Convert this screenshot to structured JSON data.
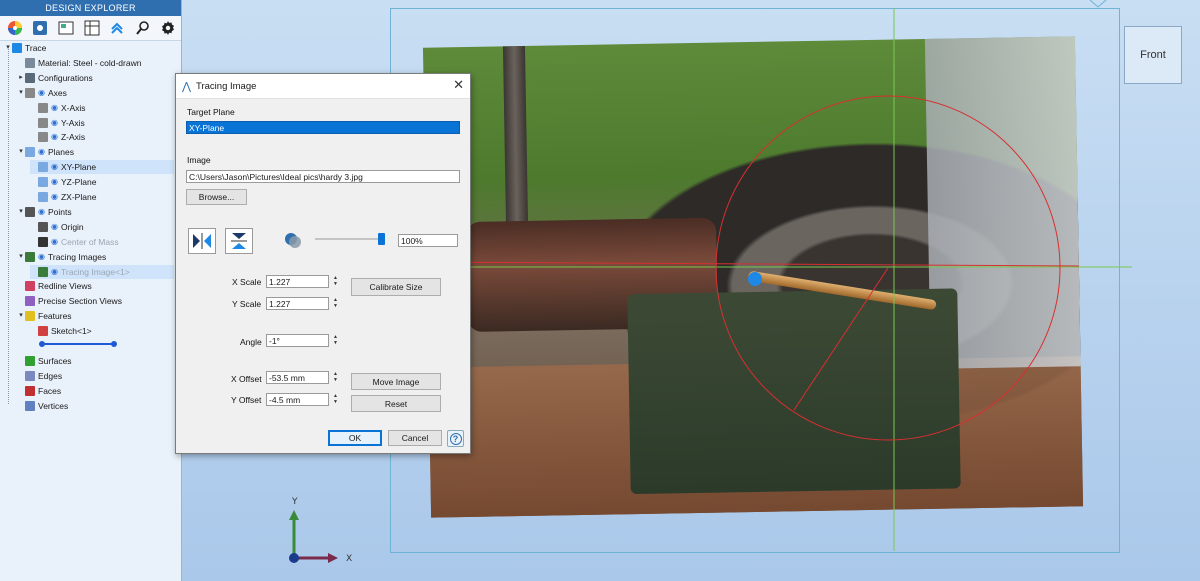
{
  "sidebar": {
    "title": "DESIGN EXPLORER",
    "toolbar_icons": [
      "color-wheel-icon",
      "settings-cube-icon",
      "image-list-icon",
      "table-icon",
      "collapse-up-icon",
      "search-icon",
      "gear-icon"
    ],
    "tree": [
      {
        "label": "Trace",
        "level": 0
      },
      {
        "label": "Material: Steel - cold-drawn",
        "level": 1
      },
      {
        "label": "Configurations",
        "level": 1
      },
      {
        "label": "Axes",
        "level": 1
      },
      {
        "label": "X-Axis",
        "level": 2
      },
      {
        "label": "Y-Axis",
        "level": 2
      },
      {
        "label": "Z-Axis",
        "level": 2
      },
      {
        "label": "Planes",
        "level": 1
      },
      {
        "label": "XY-Plane",
        "level": 2
      },
      {
        "label": "YZ-Plane",
        "level": 2
      },
      {
        "label": "ZX-Plane",
        "level": 2
      },
      {
        "label": "Points",
        "level": 1
      },
      {
        "label": "Origin",
        "level": 2
      },
      {
        "label": "Center of Mass",
        "level": 2
      },
      {
        "label": "Tracing Images",
        "level": 1
      },
      {
        "label": "Tracing Image<1>",
        "level": 2
      },
      {
        "label": "Redline Views",
        "level": 1
      },
      {
        "label": "Precise Section Views",
        "level": 1
      },
      {
        "label": "Features",
        "level": 1
      },
      {
        "label": "Sketch<1>",
        "level": 2
      },
      {
        "label": "",
        "level": 2
      },
      {
        "label": "Surfaces",
        "level": 1
      },
      {
        "label": "Edges",
        "level": 1
      },
      {
        "label": "Faces",
        "level": 1
      },
      {
        "label": "Vertices",
        "level": 1
      }
    ]
  },
  "viewport": {
    "view_button": "Front",
    "triad": {
      "x_label": "X",
      "y_label": "Y"
    }
  },
  "dialog": {
    "title": "Tracing Image",
    "target_plane_label": "Target Plane",
    "target_plane_value": "XY-Plane",
    "image_label": "Image",
    "image_path": "C:\\Users\\Jason\\Pictures\\Ideal pics\\hardy 3.jpg",
    "browse_button": "Browse...",
    "opacity_value": "100%",
    "opacity_level": 1.0,
    "x_scale_label": "X Scale",
    "x_scale_value": "1.227",
    "y_scale_label": "Y Scale",
    "y_scale_value": "1.227",
    "calibrate_button": "Calibrate Size",
    "angle_label": "Angle",
    "angle_value": "-1°",
    "x_offset_label": "X Offset",
    "x_offset_value": "-53.5 mm",
    "y_offset_label": "Y Offset",
    "y_offset_value": "-4.5 mm",
    "move_image_button": "Move Image",
    "reset_button": "Reset",
    "ok_button": "OK",
    "cancel_button": "Cancel",
    "help_icon": "?"
  }
}
